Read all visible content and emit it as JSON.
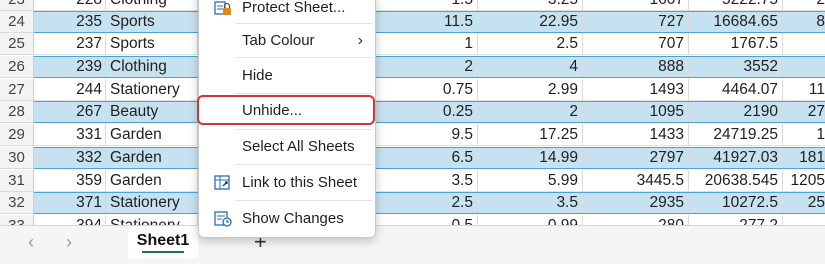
{
  "sheet": {
    "rows": [
      {
        "row": "23",
        "id": "228",
        "category": "Clothing",
        "qty": "1.5",
        "price": "3.25",
        "units": "1607",
        "revenue": "5222.75",
        "extra": "2",
        "band": false
      },
      {
        "row": "24",
        "id": "235",
        "category": "Sports",
        "qty": "11.5",
        "price": "22.95",
        "units": "727",
        "revenue": "16684.65",
        "extra": "8",
        "band": true
      },
      {
        "row": "25",
        "id": "237",
        "category": "Sports",
        "qty": "1",
        "price": "2.5",
        "units": "707",
        "revenue": "1767.5",
        "extra": "",
        "band": false
      },
      {
        "row": "26",
        "id": "239",
        "category": "Clothing",
        "qty": "2",
        "price": "4",
        "units": "888",
        "revenue": "3552",
        "extra": "",
        "band": true
      },
      {
        "row": "27",
        "id": "244",
        "category": "Stationery",
        "qty": "0.75",
        "price": "2.99",
        "units": "1493",
        "revenue": "4464.07",
        "extra": "11",
        "band": false
      },
      {
        "row": "28",
        "id": "267",
        "category": "Beauty",
        "qty": "0.25",
        "price": "2",
        "units": "1095",
        "revenue": "2190",
        "extra": "27",
        "band": true
      },
      {
        "row": "29",
        "id": "331",
        "category": "Garden",
        "qty": "9.5",
        "price": "17.25",
        "units": "1433",
        "revenue": "24719.25",
        "extra": "1",
        "band": false
      },
      {
        "row": "30",
        "id": "332",
        "category": "Garden",
        "qty": "6.5",
        "price": "14.99",
        "units": "2797",
        "revenue": "41927.03",
        "extra": "181",
        "band": true
      },
      {
        "row": "31",
        "id": "359",
        "category": "Garden",
        "qty": "3.5",
        "price": "5.99",
        "units": "3445.5",
        "revenue": "20638.545",
        "extra": "1205",
        "band": false
      },
      {
        "row": "32",
        "id": "371",
        "category": "Stationery",
        "qty": "2.5",
        "price": "3.5",
        "units": "2935",
        "revenue": "10272.5",
        "extra": "25",
        "band": true
      },
      {
        "row": "33",
        "id": "394",
        "category": "Stationery",
        "qty": "0.5",
        "price": "0.99",
        "units": "280",
        "revenue": "277.2",
        "extra": "",
        "band": false
      }
    ]
  },
  "tabs": {
    "prev_arrow": "‹",
    "next_arrow": "›",
    "active_sheet": "Sheet1",
    "add_sheet": "+"
  },
  "context_menu": {
    "items": [
      {
        "label": "Protect Sheet...",
        "icon": "protect-sheet-icon"
      },
      {
        "label": "Tab Colour",
        "submenu_arrow": "›"
      },
      {
        "label": "Hide"
      },
      {
        "label": "Unhide..."
      },
      {
        "label": "Select All Sheets"
      },
      {
        "label": "Link to this Sheet",
        "icon": "link-sheet-icon"
      },
      {
        "label": "Show Changes",
        "icon": "show-changes-icon"
      }
    ]
  },
  "colors": {
    "band_fill": "#c6e2f1",
    "band_border": "#4fa3d1",
    "active_tab_underline": "#217346",
    "highlight_outline": "#d9313a"
  }
}
